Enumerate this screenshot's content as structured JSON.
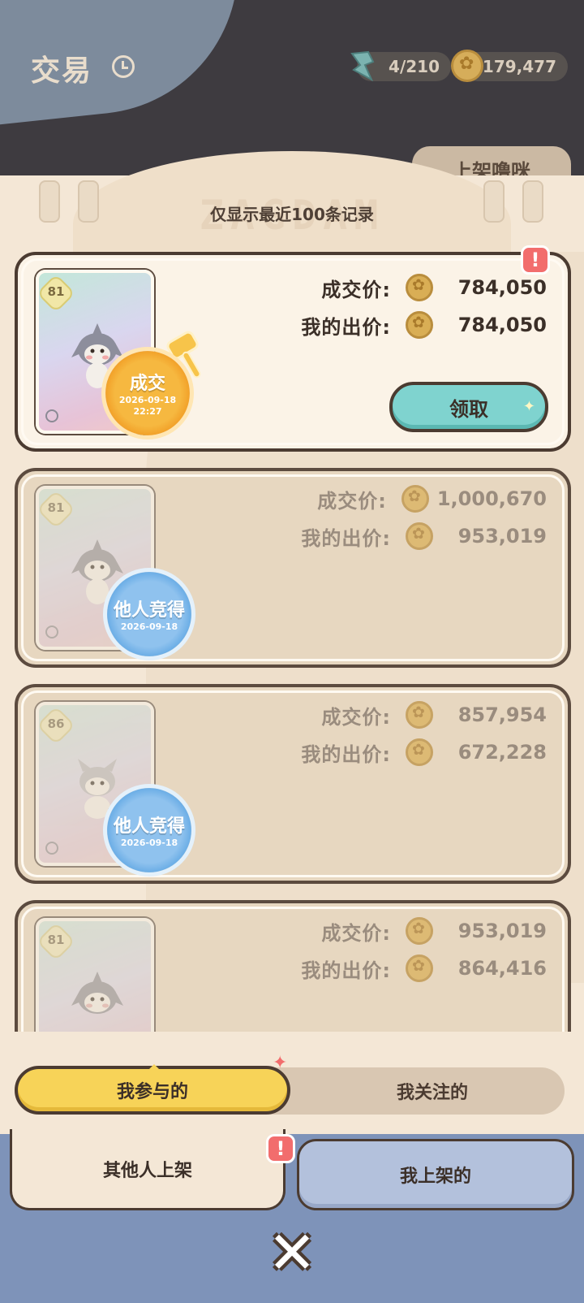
{
  "header": {
    "title": "交易",
    "energy": "4/210",
    "coins": "179,477",
    "list_button": "上架噜咪"
  },
  "notice": "仅显示最近100条记录",
  "cards": [
    {
      "status": "won",
      "level": "81",
      "stamp_title": "成交",
      "stamp_date": "2026-09-18",
      "stamp_time": "22:27",
      "deal_label": "成交价:",
      "deal_price": "784,050",
      "bid_label": "我的出价:",
      "bid_price": "784,050",
      "claim_label": "领取",
      "alert": "!"
    },
    {
      "status": "lost",
      "level": "81",
      "stamp_title": "他人竞得",
      "stamp_date": "2026-09-18",
      "deal_label": "成交价:",
      "deal_price": "1,000,670",
      "bid_label": "我的出价:",
      "bid_price": "953,019"
    },
    {
      "status": "lost",
      "level": "86",
      "stamp_title": "他人竞得",
      "stamp_date": "2026-09-18",
      "deal_label": "成交价:",
      "deal_price": "857,954",
      "bid_label": "我的出价:",
      "bid_price": "672,228"
    },
    {
      "status": "lost",
      "level": "81",
      "deal_label": "成交价:",
      "deal_price": "953,019",
      "bid_label": "我的出价:",
      "bid_price": "864,416"
    }
  ],
  "segment": {
    "active": "我参与的",
    "inactive": "我关注的"
  },
  "tabs": {
    "left": "其他人上架",
    "right": "我上架的",
    "alert": "!"
  },
  "icons": {
    "timer": "timer-icon",
    "energy": "energy-icon",
    "coin": "coin-icon",
    "close": "close-icon"
  },
  "colors": {
    "claim": "#7fd3cf",
    "segment_active": "#f7d358",
    "won_stamp": "#f6b840",
    "lost_stamp": "#8fc2ee",
    "alert": "#f26d6d"
  }
}
